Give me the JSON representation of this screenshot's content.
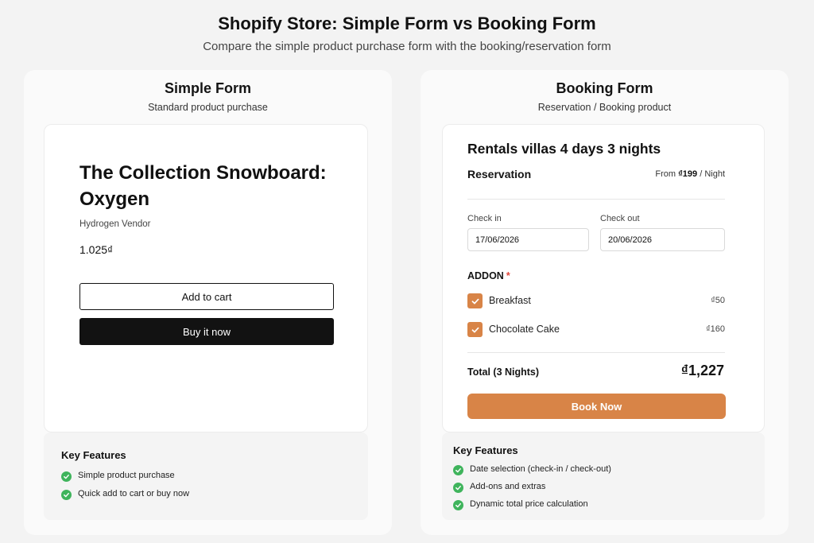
{
  "header": {
    "title": "Shopify Store: Simple Form vs Booking Form",
    "subtitle": "Compare the simple product purchase form with the booking/reservation form"
  },
  "simple": {
    "title": "Simple Form",
    "subtitle": "Standard product purchase",
    "product_title": "The Collection Snowboard: Oxygen",
    "vendor": "Hydrogen Vendor",
    "price": "1.025₫",
    "add_to_cart_label": "Add to cart",
    "buy_now_label": "Buy it now",
    "features_title": "Key Features",
    "features": [
      "Simple product purchase",
      "Quick add to cart or buy now"
    ]
  },
  "booking": {
    "title": "Booking Form",
    "subtitle": "Reservation / Booking product",
    "product_title": "Rentals villas 4 days 3 nights",
    "reservation_label": "Reservation",
    "from_text": "From",
    "from_price": "₫199",
    "per_unit": "/ Night",
    "check_in_label": "Check in",
    "check_in_value": "17/06/2026",
    "check_out_label": "Check out",
    "check_out_value": "20/06/2026",
    "addon_label": "ADDON",
    "required_mark": "*",
    "addons": [
      {
        "name": "Breakfast",
        "price": "₫50",
        "checked": true
      },
      {
        "name": "Chocolate Cake",
        "price": "₫160",
        "checked": true
      }
    ],
    "total_label": "Total (3 Nights)",
    "total_value": "₫1,227",
    "book_now_label": "Book Now",
    "features_title": "Key Features",
    "features": [
      "Date selection (check-in / check-out)",
      "Add-ons and extras",
      "Dynamic total price calculation"
    ]
  },
  "colors": {
    "accent": "#d88447",
    "check_green": "#3fb45c",
    "dark_button": "#121212",
    "required": "#e0453a"
  },
  "icons": {
    "checkbox": "checkmark-icon",
    "feature": "check-circle-icon"
  }
}
